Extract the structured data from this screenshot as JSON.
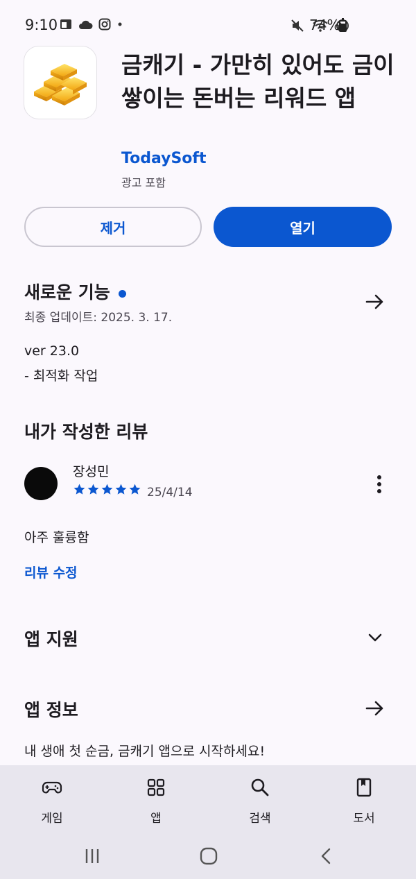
{
  "status_bar": {
    "time": "9:10",
    "battery": "74%",
    "battery_level": 0.74,
    "left_icons": [
      "calendar-icon",
      "cloud-icon",
      "instagram-icon",
      "dot-icon"
    ],
    "right_icons": [
      "mute-icon",
      "wifi-icon",
      "do-not-disturb-icon",
      "battery-icon"
    ]
  },
  "app": {
    "title": "금캐기 - 가만히 있어도 금이 쌓이는 돈버는 리워드 앱",
    "developer": "TodaySoft",
    "ads_label": "광고 포함",
    "icon": "gold-bars-icon"
  },
  "actions": {
    "uninstall_label": "제거",
    "open_label": "열기"
  },
  "whats_new": {
    "title": "새로운 기능",
    "updated": "최종 업데이트: 2025. 3. 17.",
    "version": "ver 23.0",
    "notes": "- 최적화 작업"
  },
  "my_review": {
    "title": "내가 작성한 리뷰",
    "reviewer": "장성민",
    "rating": 5,
    "date": "25/4/14",
    "text": "아주 훌륭함",
    "edit_label": "리뷰 수정"
  },
  "app_support": {
    "title": "앱 지원"
  },
  "app_info": {
    "title": "앱 정보",
    "description": "내 생애 첫 순금, 금캐기 앱으로 시작하세요!"
  },
  "bottom_nav": {
    "items": [
      {
        "label": "게임",
        "icon": "gamepad-icon"
      },
      {
        "label": "앱",
        "icon": "apps-grid-icon"
      },
      {
        "label": "검색",
        "icon": "search-icon"
      },
      {
        "label": "도서",
        "icon": "book-icon"
      }
    ]
  },
  "colors": {
    "accent": "#0b57d0",
    "background": "#fbf8fd",
    "nav_background": "#e8e6ee"
  }
}
